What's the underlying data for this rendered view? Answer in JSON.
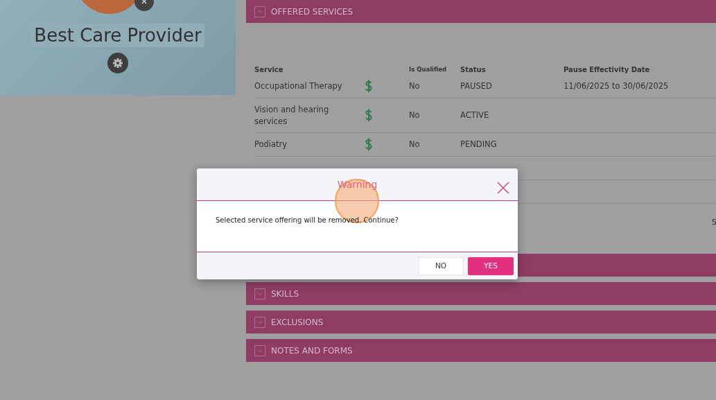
{
  "profile": {
    "name": "Best Care Provider"
  },
  "sections": [
    {
      "title": "OFFERED SERVICES",
      "expanded": true,
      "table": {
        "columns": [
          "Service",
          "Is Qualified",
          "Status",
          "Pause Effectivity Date"
        ],
        "rows": [
          {
            "service": "Occupational Therapy",
            "is_qualified": "No",
            "status": "PAUSED",
            "pause_date": "11/06/2025 to 30/06/2025"
          },
          {
            "service": "Vision and hearing services",
            "is_qualified": "No",
            "status": "ACTIVE"
          },
          {
            "service": "Podiatry",
            "is_qualified": "No",
            "status": "PENDING"
          }
        ]
      },
      "edge_text": "S"
    },
    {
      "kind": "covered"
    },
    {
      "title": "SKILLS",
      "expanded": false
    },
    {
      "title": "EXCLUSIONS",
      "expanded": false
    },
    {
      "title": "NOTES AND FORMS",
      "expanded": false
    }
  ],
  "dialog": {
    "title": "Warning",
    "message": "Selected service offering will be removed. Continue?",
    "buttons": [
      {
        "label": "NO",
        "kind": "secondary"
      },
      {
        "label": "YES",
        "kind": "primary"
      }
    ]
  }
}
